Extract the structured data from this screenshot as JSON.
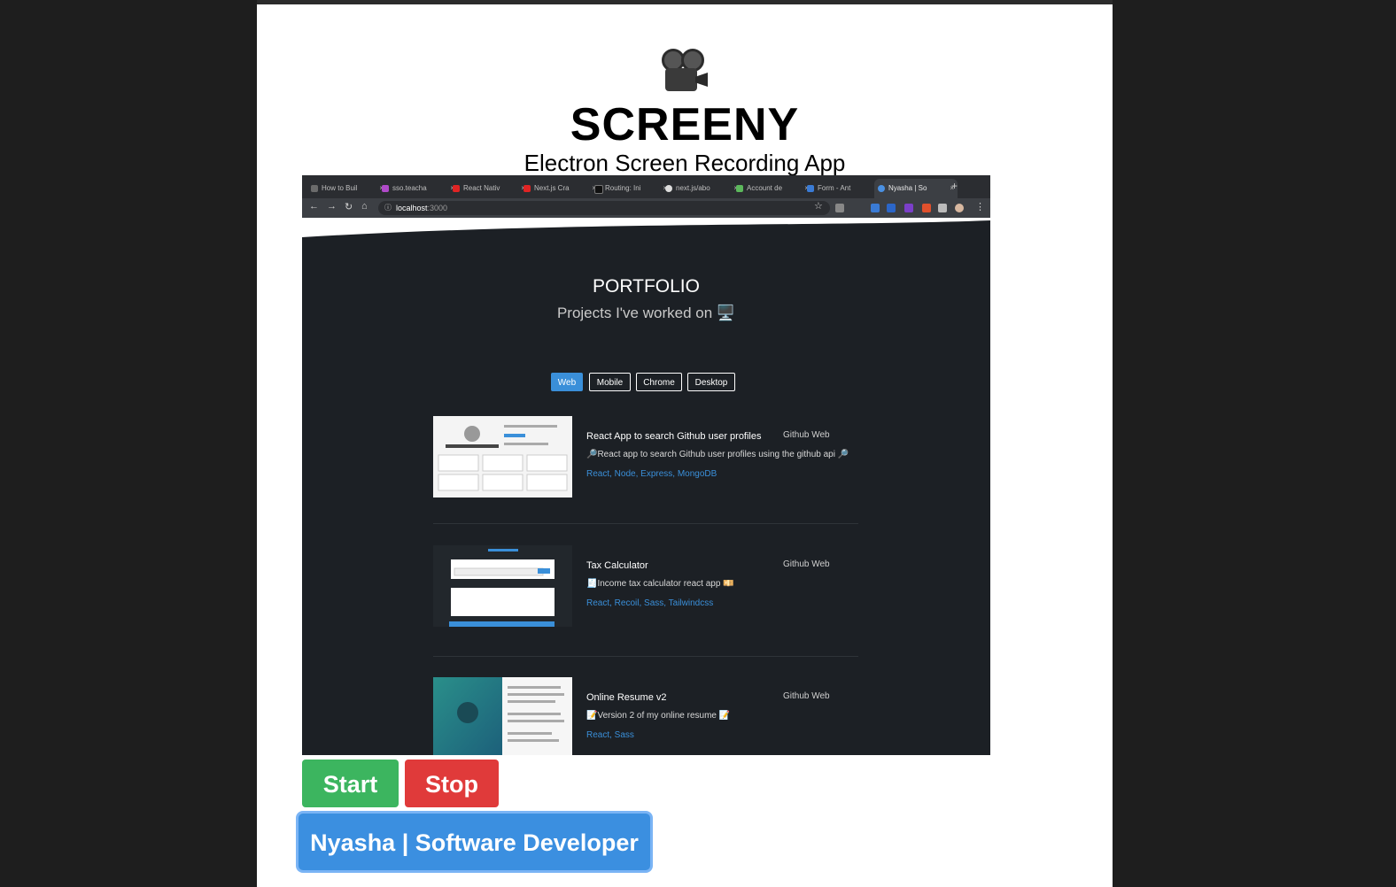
{
  "app": {
    "icon": "movie-camera-icon",
    "title": "SCREENY",
    "subtitle": "Electron Screen Recording App"
  },
  "preview": {
    "browser": {
      "tabs": [
        {
          "label": "How to Buil",
          "favicon_color": "#6b6b6b"
        },
        {
          "label": "sso.teacha",
          "favicon_color": "#b04ac9"
        },
        {
          "label": "React Nativ",
          "favicon_color": "#e02424"
        },
        {
          "label": "Next.js Cra",
          "favicon_color": "#e02424"
        },
        {
          "label": "Routing: Ini",
          "favicon_color": "#111111"
        },
        {
          "label": "next.js/abo",
          "favicon_color": "#dddddd"
        },
        {
          "label": "Account de",
          "favicon_color": "#5cb85c"
        },
        {
          "label": "Form - Ant",
          "favicon_color": "#3a7bd5"
        },
        {
          "label": "Nyasha | So",
          "favicon_color": "#4a90e2"
        }
      ],
      "url_host": "localhost",
      "url_port": ":3000"
    },
    "portfolio": {
      "title": "PORTFOLIO",
      "subtitle": "Projects I've worked on 🖥️",
      "filters": [
        "Web",
        "Mobile",
        "Chrome",
        "Desktop"
      ],
      "active_filter": "Web",
      "projects": [
        {
          "title": "React App to search Github user profiles",
          "description": "🔎React app to search Github user profiles using the github api 🔎",
          "tags": "React, Node, Express, MongoDB",
          "links": "Github  Web"
        },
        {
          "title": "Tax Calculator",
          "description": "🧾Income tax calculator react app 💴",
          "tags": "React, Recoil, Sass, Tailwindcss",
          "links": "Github  Web"
        },
        {
          "title": "Online Resume v2",
          "description": "📝Version 2 of my online resume 📝",
          "tags": "React, Sass",
          "links": "Github  Web"
        }
      ]
    }
  },
  "controls": {
    "start_label": "Start",
    "stop_label": "Stop",
    "source_label": "Nyasha | Software Developer"
  },
  "colors": {
    "start": "#3cb55f",
    "stop": "#e03a3a",
    "source": "#3b8fe0",
    "accent": "#3a8fd9"
  }
}
